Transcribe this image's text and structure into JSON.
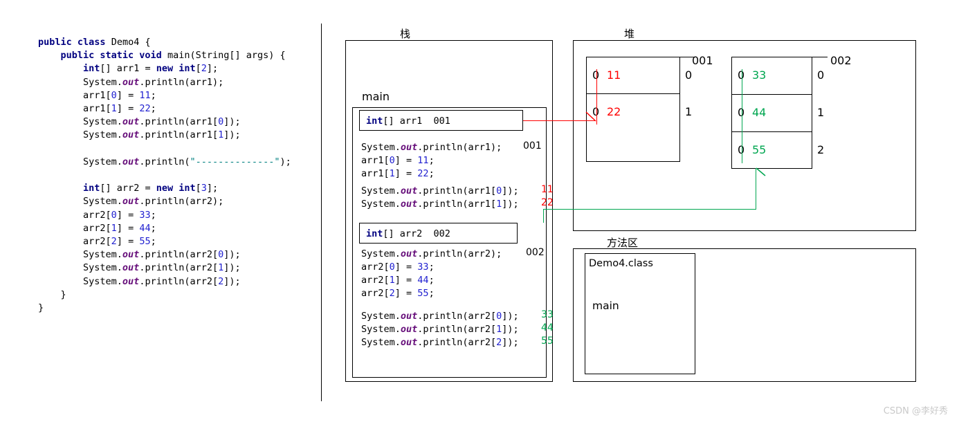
{
  "code": {
    "lines": [
      [
        {
          "t": "public ",
          "c": "kw"
        },
        {
          "t": "class ",
          "c": "kw"
        },
        {
          "t": "Demo4 {",
          "c": "plain"
        }
      ],
      [
        {
          "t": "    public static void ",
          "c": "kw"
        },
        {
          "t": "main(String[] args) {",
          "c": "plain"
        }
      ],
      [
        {
          "t": "        ",
          "c": "plain"
        },
        {
          "t": "int",
          "c": "kw"
        },
        {
          "t": "[] arr1 = ",
          "c": "plain"
        },
        {
          "t": "new ",
          "c": "kw"
        },
        {
          "t": "int",
          "c": "kw"
        },
        {
          "t": "[",
          "c": "plain"
        },
        {
          "t": "2",
          "c": "num"
        },
        {
          "t": "];",
          "c": "plain"
        }
      ],
      [
        {
          "t": "        System.",
          "c": "plain"
        },
        {
          "t": "out",
          "c": "fld"
        },
        {
          "t": ".println(arr1);",
          "c": "plain"
        }
      ],
      [
        {
          "t": "        arr1[",
          "c": "plain"
        },
        {
          "t": "0",
          "c": "num"
        },
        {
          "t": "] = ",
          "c": "plain"
        },
        {
          "t": "11",
          "c": "num"
        },
        {
          "t": ";",
          "c": "plain"
        }
      ],
      [
        {
          "t": "        arr1[",
          "c": "plain"
        },
        {
          "t": "1",
          "c": "num"
        },
        {
          "t": "] = ",
          "c": "plain"
        },
        {
          "t": "22",
          "c": "num"
        },
        {
          "t": ";",
          "c": "plain"
        }
      ],
      [
        {
          "t": "        System.",
          "c": "plain"
        },
        {
          "t": "out",
          "c": "fld"
        },
        {
          "t": ".println(arr1[",
          "c": "plain"
        },
        {
          "t": "0",
          "c": "num"
        },
        {
          "t": "]);",
          "c": "plain"
        }
      ],
      [
        {
          "t": "        System.",
          "c": "plain"
        },
        {
          "t": "out",
          "c": "fld"
        },
        {
          "t": ".println(arr1[",
          "c": "plain"
        },
        {
          "t": "1",
          "c": "num"
        },
        {
          "t": "]);",
          "c": "plain"
        }
      ],
      [
        {
          "t": "",
          "c": "plain"
        }
      ],
      [
        {
          "t": "        System.",
          "c": "plain"
        },
        {
          "t": "out",
          "c": "fld"
        },
        {
          "t": ".println(",
          "c": "plain"
        },
        {
          "t": "\"--------------\"",
          "c": "str"
        },
        {
          "t": ");",
          "c": "plain"
        }
      ],
      [
        {
          "t": "",
          "c": "plain"
        }
      ],
      [
        {
          "t": "        ",
          "c": "plain"
        },
        {
          "t": "int",
          "c": "kw"
        },
        {
          "t": "[] arr2 = ",
          "c": "plain"
        },
        {
          "t": "new ",
          "c": "kw"
        },
        {
          "t": "int",
          "c": "kw"
        },
        {
          "t": "[",
          "c": "plain"
        },
        {
          "t": "3",
          "c": "num"
        },
        {
          "t": "];",
          "c": "plain"
        }
      ],
      [
        {
          "t": "        System.",
          "c": "plain"
        },
        {
          "t": "out",
          "c": "fld"
        },
        {
          "t": ".println(arr2);",
          "c": "plain"
        }
      ],
      [
        {
          "t": "        arr2[",
          "c": "plain"
        },
        {
          "t": "0",
          "c": "num"
        },
        {
          "t": "] = ",
          "c": "plain"
        },
        {
          "t": "33",
          "c": "num"
        },
        {
          "t": ";",
          "c": "plain"
        }
      ],
      [
        {
          "t": "        arr2[",
          "c": "plain"
        },
        {
          "t": "1",
          "c": "num"
        },
        {
          "t": "] = ",
          "c": "plain"
        },
        {
          "t": "44",
          "c": "num"
        },
        {
          "t": ";",
          "c": "plain"
        }
      ],
      [
        {
          "t": "        arr2[",
          "c": "plain"
        },
        {
          "t": "2",
          "c": "num"
        },
        {
          "t": "] = ",
          "c": "plain"
        },
        {
          "t": "55",
          "c": "num"
        },
        {
          "t": ";",
          "c": "plain"
        }
      ],
      [
        {
          "t": "        System.",
          "c": "plain"
        },
        {
          "t": "out",
          "c": "fld"
        },
        {
          "t": ".println(arr2[",
          "c": "plain"
        },
        {
          "t": "0",
          "c": "num"
        },
        {
          "t": "]);",
          "c": "plain"
        }
      ],
      [
        {
          "t": "        System.",
          "c": "plain"
        },
        {
          "t": "out",
          "c": "fld"
        },
        {
          "t": ".println(arr2[",
          "c": "plain"
        },
        {
          "t": "1",
          "c": "num"
        },
        {
          "t": "]);",
          "c": "plain"
        }
      ],
      [
        {
          "t": "        System.",
          "c": "plain"
        },
        {
          "t": "out",
          "c": "fld"
        },
        {
          "t": ".println(arr2[",
          "c": "plain"
        },
        {
          "t": "2",
          "c": "num"
        },
        {
          "t": "]);",
          "c": "plain"
        }
      ],
      [
        {
          "t": "    }",
          "c": "plain"
        }
      ],
      [
        {
          "t": "}",
          "c": "plain"
        }
      ]
    ]
  },
  "regions": {
    "stack_caption": "栈",
    "heap_caption": "堆",
    "method_caption": "方法区"
  },
  "stack": {
    "frame_label": "main",
    "var1": [
      {
        "t": "int",
        "c": "kw"
      },
      {
        "t": "[] arr1  001",
        "c": "plain"
      }
    ],
    "var2": [
      {
        "t": "int",
        "c": "kw"
      },
      {
        "t": "[] arr2  002",
        "c": "plain"
      }
    ],
    "lines_group1": [
      {
        "code": [
          {
            "t": "System.",
            "c": "plain"
          },
          {
            "t": "out",
            "c": "fld"
          },
          {
            "t": ".println(arr1);",
            "c": "plain"
          }
        ],
        "note": "001",
        "note_color": "#000000"
      },
      {
        "code": [
          {
            "t": "arr1[",
            "c": "plain"
          },
          {
            "t": "0",
            "c": "num"
          },
          {
            "t": "] = ",
            "c": "plain"
          },
          {
            "t": "11",
            "c": "num"
          },
          {
            "t": ";",
            "c": "plain"
          }
        ],
        "note": "",
        "note_color": "#000000"
      },
      {
        "code": [
          {
            "t": "arr1[",
            "c": "plain"
          },
          {
            "t": "1",
            "c": "num"
          },
          {
            "t": "] = ",
            "c": "plain"
          },
          {
            "t": "22",
            "c": "num"
          },
          {
            "t": ";",
            "c": "plain"
          }
        ],
        "note": "",
        "note_color": "#000000"
      }
    ],
    "lines_group2": [
      {
        "code": [
          {
            "t": "System.",
            "c": "plain"
          },
          {
            "t": "out",
            "c": "fld"
          },
          {
            "t": ".println(arr1[",
            "c": "plain"
          },
          {
            "t": "0",
            "c": "num"
          },
          {
            "t": "]);",
            "c": "plain"
          }
        ],
        "note": "11",
        "note_color": "#ff0000"
      },
      {
        "code": [
          {
            "t": "System.",
            "c": "plain"
          },
          {
            "t": "out",
            "c": "fld"
          },
          {
            "t": ".println(arr1[",
            "c": "plain"
          },
          {
            "t": "1",
            "c": "num"
          },
          {
            "t": "]);",
            "c": "plain"
          }
        ],
        "note": "22",
        "note_color": "#ff0000"
      }
    ],
    "lines_group3": [
      {
        "code": [
          {
            "t": "System.",
            "c": "plain"
          },
          {
            "t": "out",
            "c": "fld"
          },
          {
            "t": ".println(arr2);",
            "c": "plain"
          }
        ],
        "note": "002",
        "note_color": "#000000"
      },
      {
        "code": [
          {
            "t": "arr2[",
            "c": "plain"
          },
          {
            "t": "0",
            "c": "num"
          },
          {
            "t": "] = ",
            "c": "plain"
          },
          {
            "t": "33",
            "c": "num"
          },
          {
            "t": ";",
            "c": "plain"
          }
        ],
        "note": "",
        "note_color": "#000000"
      },
      {
        "code": [
          {
            "t": "arr2[",
            "c": "plain"
          },
          {
            "t": "1",
            "c": "num"
          },
          {
            "t": "] = ",
            "c": "plain"
          },
          {
            "t": "44",
            "c": "num"
          },
          {
            "t": ";",
            "c": "plain"
          }
        ],
        "note": "",
        "note_color": "#000000"
      },
      {
        "code": [
          {
            "t": "arr2[",
            "c": "plain"
          },
          {
            "t": "2",
            "c": "num"
          },
          {
            "t": "] = ",
            "c": "plain"
          },
          {
            "t": "55",
            "c": "num"
          },
          {
            "t": ";",
            "c": "plain"
          }
        ],
        "note": "",
        "note_color": "#000000"
      }
    ],
    "lines_group4": [
      {
        "code": [
          {
            "t": "System.",
            "c": "plain"
          },
          {
            "t": "out",
            "c": "fld"
          },
          {
            "t": ".println(arr2[",
            "c": "plain"
          },
          {
            "t": "0",
            "c": "num"
          },
          {
            "t": "]);",
            "c": "plain"
          }
        ],
        "note": "33",
        "note_color": "#00a650"
      },
      {
        "code": [
          {
            "t": "System.",
            "c": "plain"
          },
          {
            "t": "out",
            "c": "fld"
          },
          {
            "t": ".println(arr2[",
            "c": "plain"
          },
          {
            "t": "1",
            "c": "num"
          },
          {
            "t": "]);",
            "c": "plain"
          }
        ],
        "note": "44",
        "note_color": "#00a650"
      },
      {
        "code": [
          {
            "t": "System.",
            "c": "plain"
          },
          {
            "t": "out",
            "c": "fld"
          },
          {
            "t": ".println(arr2[",
            "c": "plain"
          },
          {
            "t": "2",
            "c": "num"
          },
          {
            "t": "]);",
            "c": "plain"
          }
        ],
        "note": "55",
        "note_color": "#00a650"
      }
    ]
  },
  "heap": {
    "arrays": [
      {
        "address": "001",
        "accent": "#ff0000",
        "length": 2,
        "cells": [
          {
            "index": "0",
            "default": "0",
            "value": "11"
          },
          {
            "index": "1",
            "default": "0",
            "value": "22"
          }
        ]
      },
      {
        "address": "002",
        "accent": "#00a650",
        "length": 3,
        "cells": [
          {
            "index": "0",
            "default": "0",
            "value": "33"
          },
          {
            "index": "1",
            "default": "0",
            "value": "44"
          },
          {
            "index": "2",
            "default": "0",
            "value": "55"
          }
        ]
      }
    ]
  },
  "method_area": {
    "class_name": "Demo4.class",
    "method_name": "main"
  },
  "watermark": "CSDN @李好秀"
}
